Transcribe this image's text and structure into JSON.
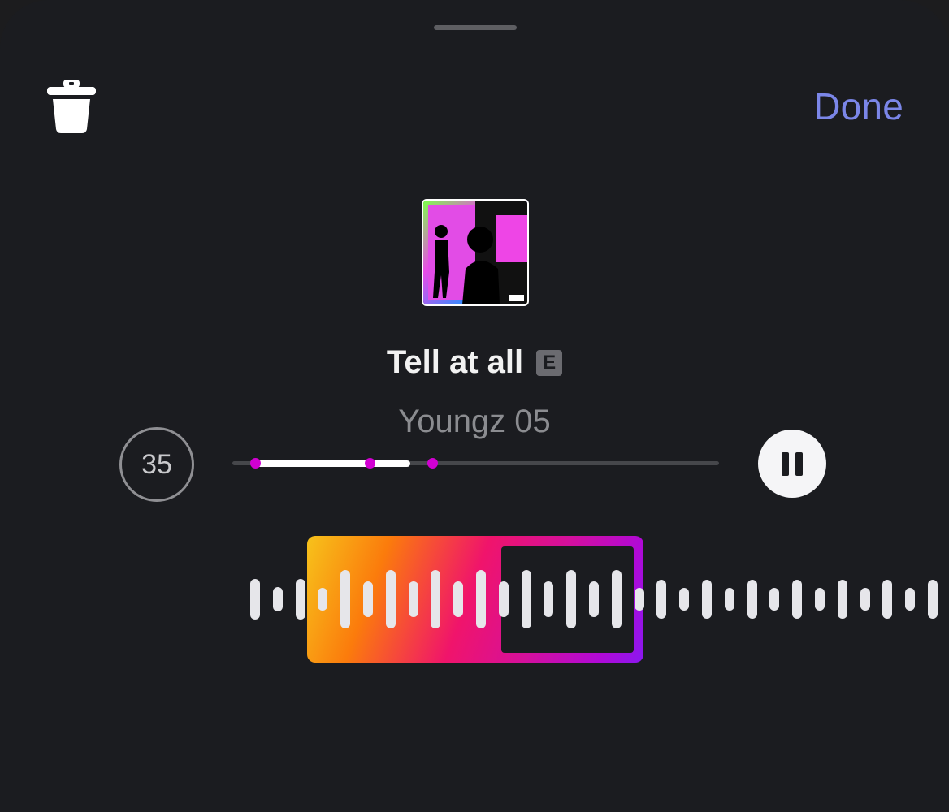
{
  "header": {
    "done_label": "Done",
    "delete_icon": "trash-icon"
  },
  "track": {
    "title": "Tell at all",
    "explicit_badge": "E",
    "artist": "Youngz 05",
    "clip_seconds": "35",
    "playback": "playing",
    "progress_fraction": 0.35
  },
  "colors": {
    "accent_done": "#7b86e8",
    "marker": "#d200d2",
    "gradient": [
      "#f7c21b",
      "#fb7b0c",
      "#f0146b",
      "#d6109a",
      "#8a18f0"
    ]
  }
}
